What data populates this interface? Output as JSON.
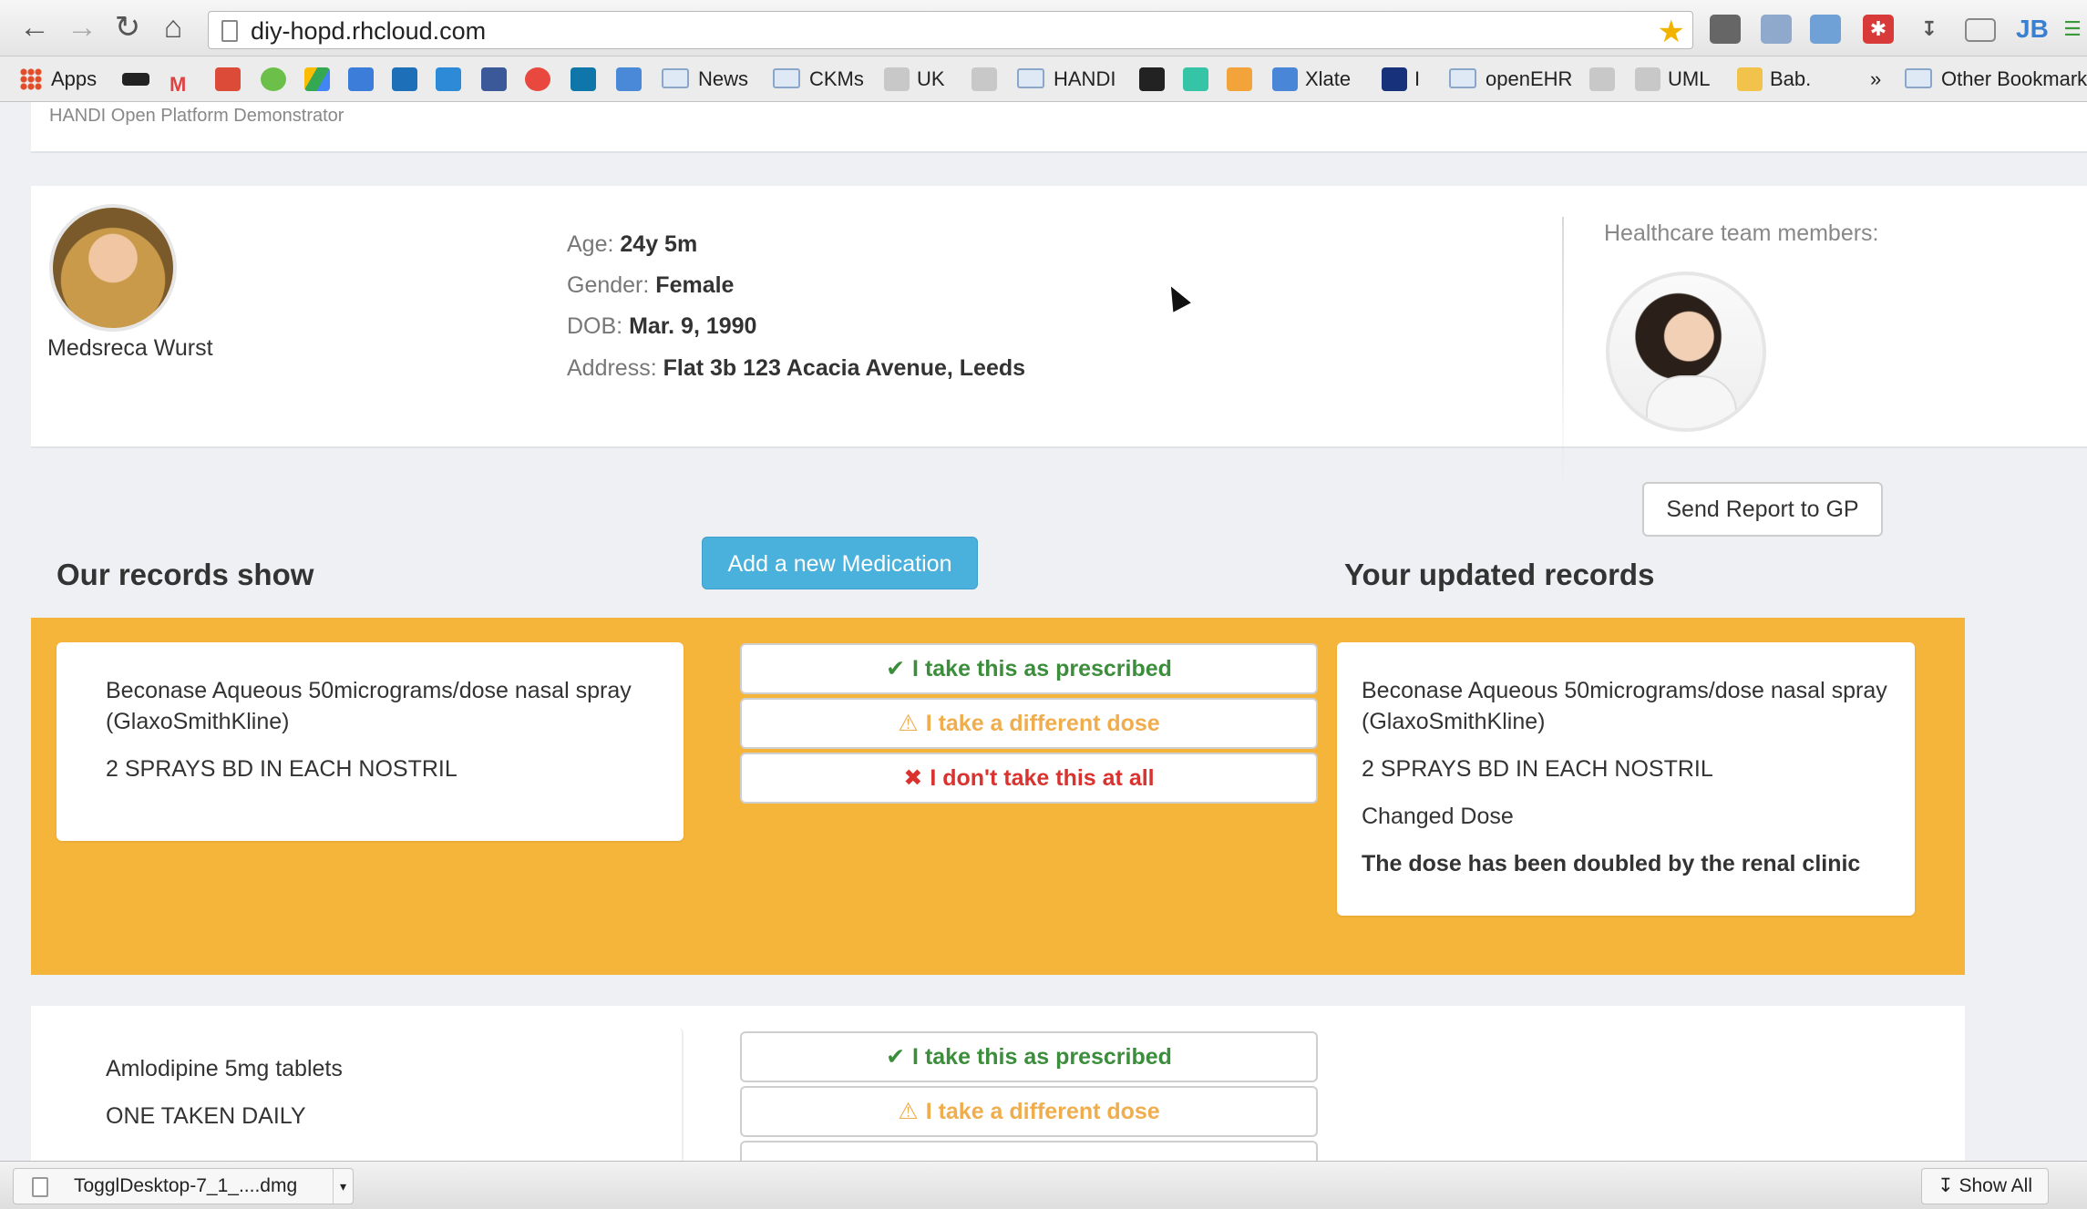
{
  "browser": {
    "url": "diy-hopd.rhcloud.com",
    "bookmarks": {
      "apps": "Apps",
      "news": "News",
      "ckms": "CKMs",
      "uk": "UK",
      "handi": "HANDI",
      "xlate": "Xlate",
      "i": "I",
      "openehr": "openEHR",
      "uml": "UML",
      "bab": "Bab.",
      "more": "»",
      "other": "Other Bookmark"
    }
  },
  "header": {
    "subtitle": "HANDI Open Platform Demonstrator"
  },
  "patient": {
    "name": "Medsreca Wurst",
    "age_label": "Age:",
    "age": "24y 5m",
    "gender_label": "Gender:",
    "gender": "Female",
    "dob_label": "DOB:",
    "dob": "Mar. 9, 1990",
    "address_label": "Address:",
    "address": "Flat 3b 123 Acacia Avenue, Leeds"
  },
  "team": {
    "title": "Healthcare team members:"
  },
  "actions": {
    "send_report": "Send Report to GP",
    "add_medication": "Add a new Medication"
  },
  "sections": {
    "left_title": "Our records show",
    "right_title": "Your updated records"
  },
  "choices": {
    "as_prescribed": "I take this as prescribed",
    "different_dose": "I take a different dose",
    "not_taken": "I don't take this at all"
  },
  "medications": [
    {
      "name": "Beconase Aqueous 50micrograms/dose nasal spray (GlaxoSmithKline)",
      "dose": "2 SPRAYS BD IN EACH NOSTRIL",
      "updated": {
        "name": "Beconase Aqueous 50micrograms/dose nasal spray (GlaxoSmithKline)",
        "dose": "2 SPRAYS BD IN EACH NOSTRIL",
        "status": "Changed Dose",
        "note": "The dose has been doubled by the renal clinic"
      }
    },
    {
      "name": "Amlodipine 5mg tablets",
      "dose": "ONE TAKEN DAILY"
    }
  ],
  "downloads": {
    "file": "TogglDesktop-7_1_....dmg",
    "show_all": "Show All"
  },
  "colors": {
    "accent_blue": "#4ab0dc",
    "highlight_orange": "#f5b43a",
    "ok_green": "#3c8d3c",
    "warn_orange": "#f0ad4e",
    "error_red": "#d9322f"
  }
}
